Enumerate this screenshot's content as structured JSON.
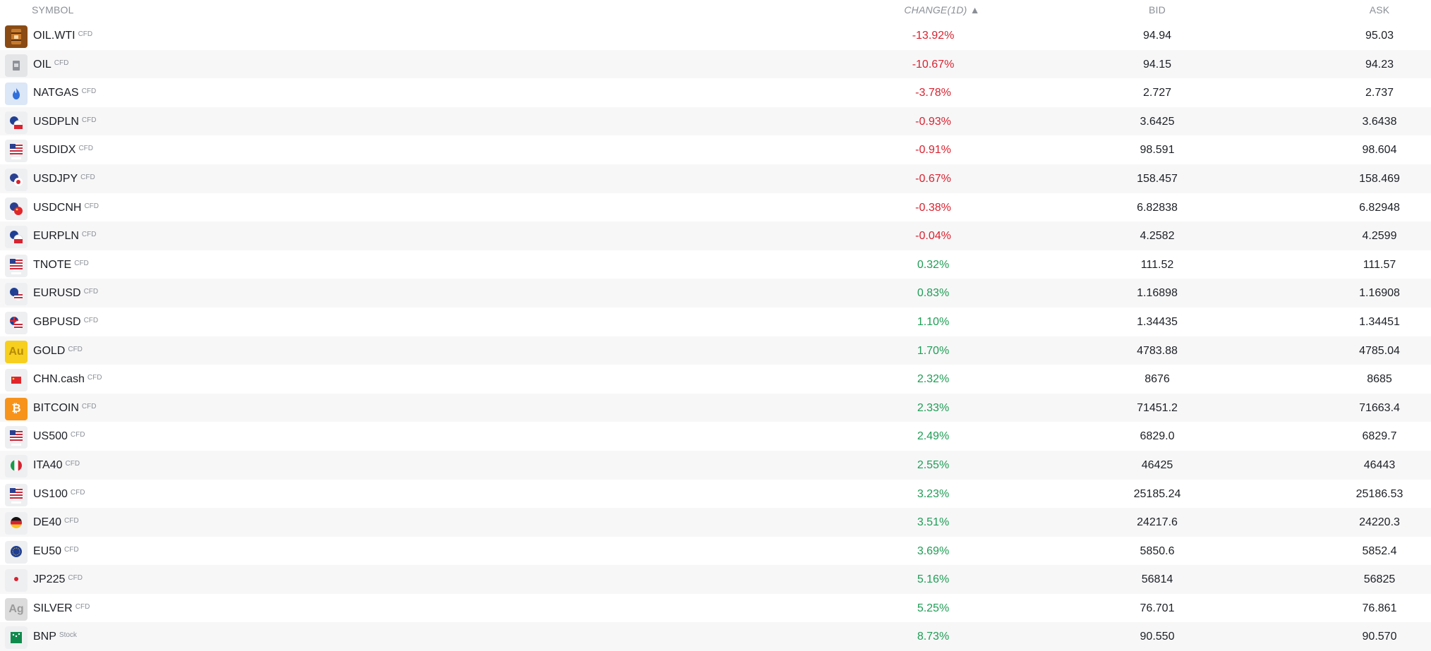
{
  "headers": {
    "symbol": "SYMBOL",
    "change": "CHANGE(1D) ▲",
    "bid": "BID",
    "ask": "ASK"
  },
  "colors": {
    "negative": "#d8222f",
    "positive": "#1f9d55",
    "row_alt": "#f7f7f8"
  },
  "rows": [
    {
      "symbol": "OIL.WTI",
      "tag": "CFD",
      "change": "-13.92%",
      "bid": "94.94",
      "ask": "95.03",
      "icon": "oil-barrel-icon"
    },
    {
      "symbol": "OIL",
      "tag": "CFD",
      "change": "-10.67%",
      "bid": "94.15",
      "ask": "94.23",
      "icon": "oil-icon"
    },
    {
      "symbol": "NATGAS",
      "tag": "CFD",
      "change": "-3.78%",
      "bid": "2.727",
      "ask": "2.737",
      "icon": "flame-icon"
    },
    {
      "symbol": "USDPLN",
      "tag": "CFD",
      "change": "-0.93%",
      "bid": "3.6425",
      "ask": "3.6438",
      "icon": "usd-pln-flag-icon"
    },
    {
      "symbol": "USDIDX",
      "tag": "CFD",
      "change": "-0.91%",
      "bid": "98.591",
      "ask": "98.604",
      "icon": "us-flag-icon"
    },
    {
      "symbol": "USDJPY",
      "tag": "CFD",
      "change": "-0.67%",
      "bid": "158.457",
      "ask": "158.469",
      "icon": "usd-jpy-flag-icon"
    },
    {
      "symbol": "USDCNH",
      "tag": "CFD",
      "change": "-0.38%",
      "bid": "6.82838",
      "ask": "6.82948",
      "icon": "usd-cnh-flag-icon"
    },
    {
      "symbol": "EURPLN",
      "tag": "CFD",
      "change": "-0.04%",
      "bid": "4.2582",
      "ask": "4.2599",
      "icon": "eur-pln-flag-icon"
    },
    {
      "symbol": "TNOTE",
      "tag": "CFD",
      "change": "0.32%",
      "bid": "111.52",
      "ask": "111.57",
      "icon": "us-flag-icon"
    },
    {
      "symbol": "EURUSD",
      "tag": "CFD",
      "change": "0.83%",
      "bid": "1.16898",
      "ask": "1.16908",
      "icon": "eur-usd-flag-icon"
    },
    {
      "symbol": "GBPUSD",
      "tag": "CFD",
      "change": "1.10%",
      "bid": "1.34435",
      "ask": "1.34451",
      "icon": "gbp-usd-flag-icon"
    },
    {
      "symbol": "GOLD",
      "tag": "CFD",
      "change": "1.70%",
      "bid": "4783.88",
      "ask": "4785.04",
      "icon": "gold-icon",
      "icon_text": "Au"
    },
    {
      "symbol": "CHN.cash",
      "tag": "CFD",
      "change": "2.32%",
      "bid": "8676",
      "ask": "8685",
      "icon": "china-flag-icon"
    },
    {
      "symbol": "BITCOIN",
      "tag": "CFD",
      "change": "2.33%",
      "bid": "71451.2",
      "ask": "71663.4",
      "icon": "bitcoin-icon",
      "icon_text": "₿"
    },
    {
      "symbol": "US500",
      "tag": "CFD",
      "change": "2.49%",
      "bid": "6829.0",
      "ask": "6829.7",
      "icon": "us-flag-icon"
    },
    {
      "symbol": "ITA40",
      "tag": "CFD",
      "change": "2.55%",
      "bid": "46425",
      "ask": "46443",
      "icon": "italy-flag-icon"
    },
    {
      "symbol": "US100",
      "tag": "CFD",
      "change": "3.23%",
      "bid": "25185.24",
      "ask": "25186.53",
      "icon": "us-flag-icon"
    },
    {
      "symbol": "DE40",
      "tag": "CFD",
      "change": "3.51%",
      "bid": "24217.6",
      "ask": "24220.3",
      "icon": "germany-flag-icon"
    },
    {
      "symbol": "EU50",
      "tag": "CFD",
      "change": "3.69%",
      "bid": "5850.6",
      "ask": "5852.4",
      "icon": "eu-flag-icon"
    },
    {
      "symbol": "JP225",
      "tag": "CFD",
      "change": "5.16%",
      "bid": "56814",
      "ask": "56825",
      "icon": "japan-flag-icon"
    },
    {
      "symbol": "SILVER",
      "tag": "CFD",
      "change": "5.25%",
      "bid": "76.701",
      "ask": "76.861",
      "icon": "silver-icon",
      "icon_text": "Ag"
    },
    {
      "symbol": "BNP",
      "tag": "Stock",
      "change": "8.73%",
      "bid": "90.550",
      "ask": "90.570",
      "icon": "bnp-logo-icon"
    }
  ]
}
